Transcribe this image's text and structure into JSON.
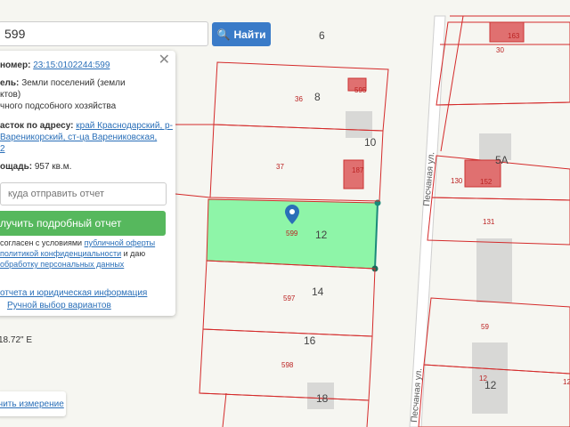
{
  "search": {
    "value": "599",
    "button_label": "Найти"
  },
  "panel": {
    "number_label": "номер:",
    "number_value": "23:15:0102244:599",
    "category_label": "ель:",
    "category_line1": "Земли поселений (земли",
    "category_line2": "ктов)",
    "category_line3": "чного подсобного хозяйства",
    "address_label": "асток по адресу:",
    "address_line1": "край Краснодарский, р-",
    "address_line2": "Вареникорский, ст-ца Варениковская,",
    "address_line3": "2",
    "area_label": "ощадь:",
    "area_value": "957 кв.м.",
    "email_placeholder": "куда отправить отчет",
    "report_button": "лучить подробный отчет",
    "consent_1": "согласен с условиями ",
    "consent_link1": "публичной оферты",
    "consent_2": "политикой конфиденциальности",
    "consent_3": " и даю",
    "consent_4": "обработку персональных данных",
    "legal_link": "отчета и юридическая информация",
    "manual_link": "Ручной выбор вариантов"
  },
  "coordinate_text": "18.72\" E",
  "measure_link": "чить измерение",
  "map": {
    "street_label": "Песчаная ул.",
    "house_numbers": [
      "6",
      "8",
      "10",
      "12",
      "14",
      "16",
      "18",
      "5А",
      "12"
    ],
    "plot_labels": [
      "163",
      "30",
      "595",
      "36",
      "37",
      "187",
      "130",
      "152",
      "131",
      "599",
      "597",
      "598",
      "59",
      "12",
      "12"
    ],
    "selected_plot_color": "#8ef5a8",
    "border_color": "#d42a2a"
  }
}
